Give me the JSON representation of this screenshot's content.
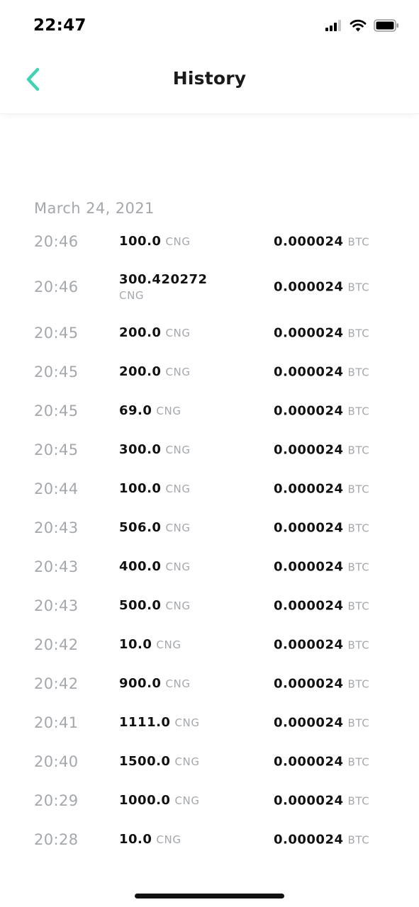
{
  "status_bar": {
    "time": "22:47",
    "icons": [
      "cellular-signal-icon",
      "wifi-icon",
      "battery-icon"
    ]
  },
  "header": {
    "title": "History",
    "back_icon": "chevron-left-icon",
    "accent_color": "#3fd3b4"
  },
  "history": {
    "date": "March 24, 2021",
    "transactions": [
      {
        "time": "20:46",
        "amount": "100.0",
        "amount_unit": "CNG",
        "price": "0.000024",
        "price_unit": "BTC"
      },
      {
        "time": "20:46",
        "amount": "300.420272",
        "amount_unit": "CNG",
        "price": "0.000024",
        "price_unit": "BTC"
      },
      {
        "time": "20:45",
        "amount": "200.0",
        "amount_unit": "CNG",
        "price": "0.000024",
        "price_unit": "BTC"
      },
      {
        "time": "20:45",
        "amount": "200.0",
        "amount_unit": "CNG",
        "price": "0.000024",
        "price_unit": "BTC"
      },
      {
        "time": "20:45",
        "amount": "69.0",
        "amount_unit": "CNG",
        "price": "0.000024",
        "price_unit": "BTC"
      },
      {
        "time": "20:45",
        "amount": "300.0",
        "amount_unit": "CNG",
        "price": "0.000024",
        "price_unit": "BTC"
      },
      {
        "time": "20:44",
        "amount": "100.0",
        "amount_unit": "CNG",
        "price": "0.000024",
        "price_unit": "BTC"
      },
      {
        "time": "20:43",
        "amount": "506.0",
        "amount_unit": "CNG",
        "price": "0.000024",
        "price_unit": "BTC"
      },
      {
        "time": "20:43",
        "amount": "400.0",
        "amount_unit": "CNG",
        "price": "0.000024",
        "price_unit": "BTC"
      },
      {
        "time": "20:43",
        "amount": "500.0",
        "amount_unit": "CNG",
        "price": "0.000024",
        "price_unit": "BTC"
      },
      {
        "time": "20:42",
        "amount": "10.0",
        "amount_unit": "CNG",
        "price": "0.000024",
        "price_unit": "BTC"
      },
      {
        "time": "20:42",
        "amount": "900.0",
        "amount_unit": "CNG",
        "price": "0.000024",
        "price_unit": "BTC"
      },
      {
        "time": "20:41",
        "amount": "1111.0",
        "amount_unit": "CNG",
        "price": "0.000024",
        "price_unit": "BTC"
      },
      {
        "time": "20:40",
        "amount": "1500.0",
        "amount_unit": "CNG",
        "price": "0.000024",
        "price_unit": "BTC"
      },
      {
        "time": "20:29",
        "amount": "1000.0",
        "amount_unit": "CNG",
        "price": "0.000024",
        "price_unit": "BTC"
      },
      {
        "time": "20:28",
        "amount": "10.0",
        "amount_unit": "CNG",
        "price": "0.000024",
        "price_unit": "BTC"
      }
    ]
  }
}
